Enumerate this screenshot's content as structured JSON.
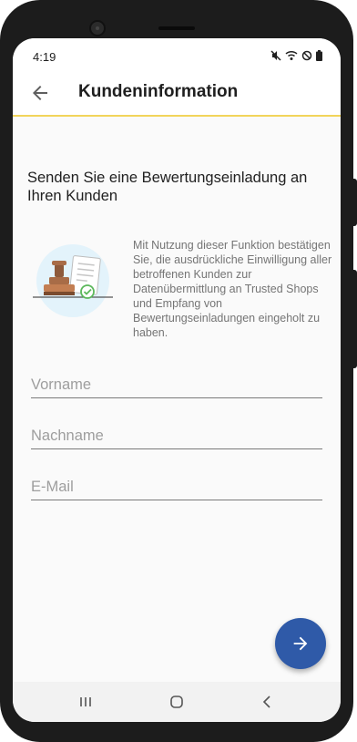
{
  "status_bar": {
    "time": "4:19",
    "icons": [
      "mute-icon",
      "wifi-icon",
      "do-not-disturb-icon",
      "battery-icon"
    ]
  },
  "app_bar": {
    "title": "Kundeninformation",
    "back_icon": "arrow-back-icon",
    "accent_color": "#f2d45a"
  },
  "main": {
    "headline": "Senden Sie eine Bewertungseinladung an Ihren Kunden",
    "illustration": "stamp-document-icon",
    "consent_text": "Mit Nutzung dieser Funktion bestätigen Sie, die ausdrückliche Einwilligung aller betroffenen Kunden zur Datenübermittlung an Trusted Shops und Empfang von Bewertungseinladungen eingeholt zu haben.",
    "fields": {
      "first_name": {
        "placeholder": "Vorname",
        "value": ""
      },
      "last_name": {
        "placeholder": "Nachname",
        "value": ""
      },
      "email": {
        "placeholder": "E-Mail",
        "value": ""
      }
    }
  },
  "fab": {
    "icon": "arrow-forward-icon",
    "color": "#2f5aa8"
  },
  "nav_bar": {
    "icons": [
      "recent-apps-icon",
      "home-icon",
      "back-nav-icon"
    ]
  }
}
